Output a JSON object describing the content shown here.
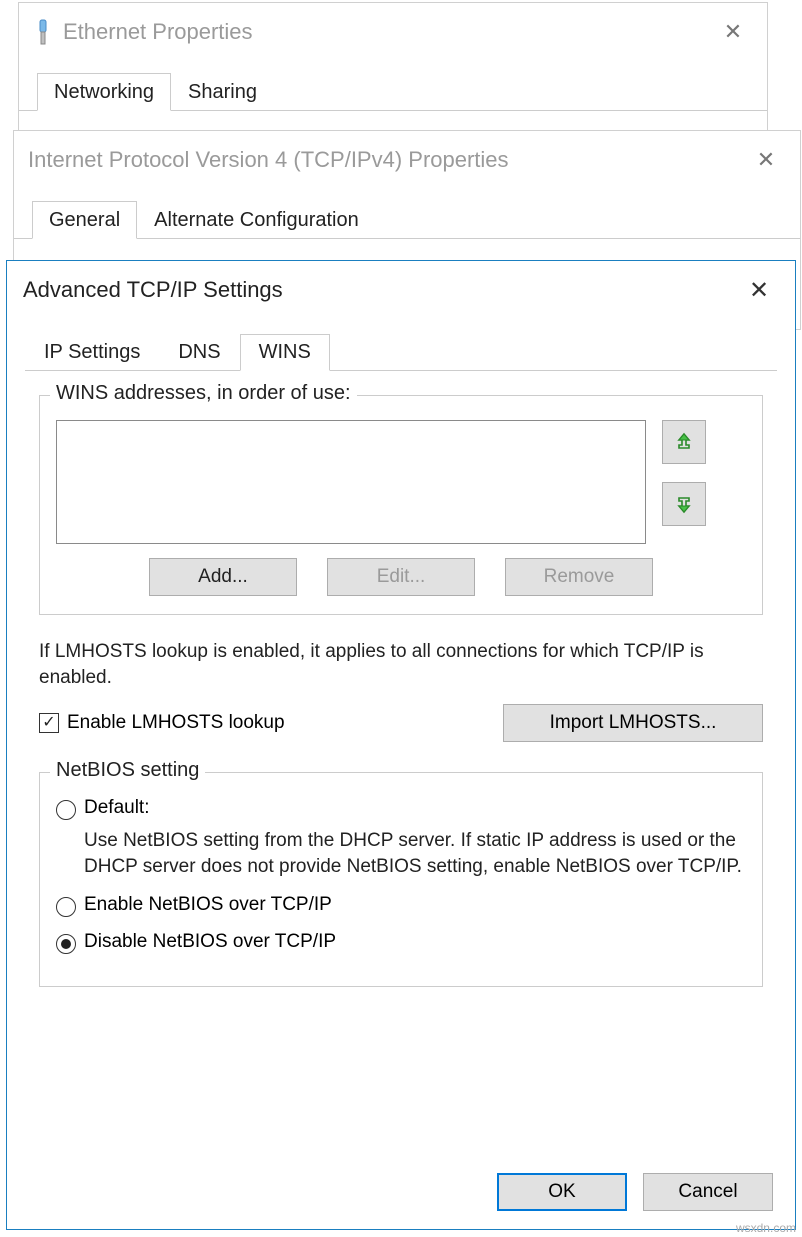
{
  "ethernet": {
    "title": "Ethernet Properties",
    "tabs": {
      "networking": "Networking",
      "sharing": "Sharing"
    }
  },
  "ipv4": {
    "title": "Internet Protocol Version 4 (TCP/IPv4) Properties",
    "tabs": {
      "general": "General",
      "alternate": "Alternate Configuration"
    }
  },
  "advanced": {
    "title": "Advanced TCP/IP Settings",
    "tabs": {
      "ip": "IP Settings",
      "dns": "DNS",
      "wins": "WINS"
    },
    "wins": {
      "group_label": "WINS addresses, in order of use:",
      "add": "Add...",
      "edit": "Edit...",
      "remove": "Remove",
      "lmhosts_info": "If LMHOSTS lookup is enabled, it applies to all connections for which TCP/IP is enabled.",
      "enable_lmhosts": "Enable LMHOSTS lookup",
      "import_lmhosts": "Import LMHOSTS...",
      "netbios": {
        "group_label": "NetBIOS setting",
        "default_label": "Default:",
        "default_desc": "Use NetBIOS setting from the DHCP server. If static IP address is used or the DHCP server does not provide NetBIOS setting, enable NetBIOS over TCP/IP.",
        "enable_label": "Enable NetBIOS over TCP/IP",
        "disable_label": "Disable NetBIOS over TCP/IP"
      }
    },
    "ok": "OK",
    "cancel": "Cancel"
  },
  "watermark": "wsxdn.com"
}
